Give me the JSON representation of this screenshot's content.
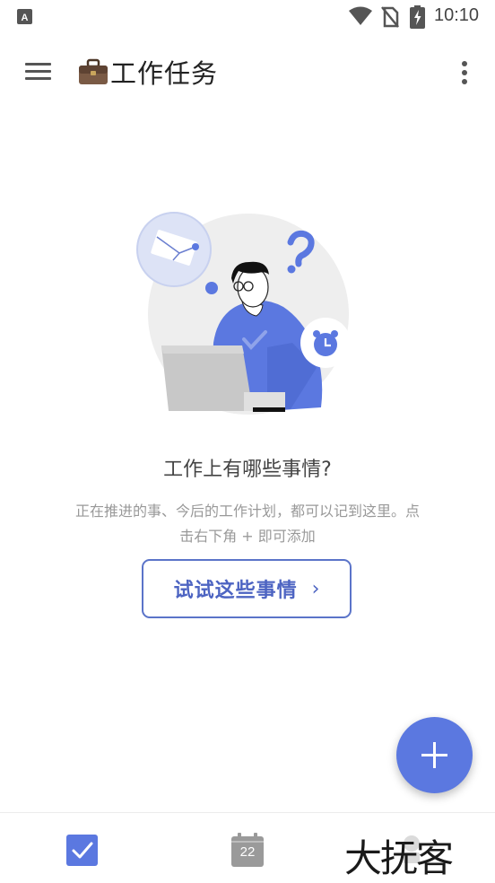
{
  "status_bar": {
    "time": "10:10",
    "icons": [
      "app-notification-icon",
      "wifi-icon",
      "no-sim-icon",
      "battery-charging-icon"
    ]
  },
  "app_bar": {
    "title": "工作任务",
    "title_icon": "briefcase-icon",
    "menu_icon": "hamburger-menu-icon",
    "more_icon": "more-vertical-icon"
  },
  "empty_state": {
    "title": "工作上有哪些事情?",
    "description": "正在推进的事、今后的工作计划，都可以记到这里。点击右下角 + 即可添加",
    "button_label": "试试这些事情",
    "button_chevron": "›"
  },
  "fab": {
    "icon": "plus-icon"
  },
  "bottom_nav": {
    "calendar_date": "22",
    "items": [
      "tasks-check-icon",
      "calendar-icon",
      "more-tab-icon"
    ]
  },
  "watermark": {
    "text": "大抚客"
  },
  "colors": {
    "accent": "#5b78e0",
    "button_border": "#5b74c9",
    "illustration_blue": "#5b78e0"
  }
}
